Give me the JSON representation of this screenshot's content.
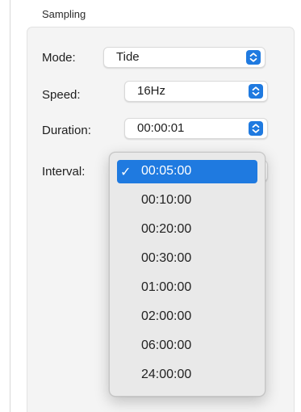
{
  "group": {
    "title": "Sampling"
  },
  "fields": {
    "mode": {
      "label": "Mode:",
      "value": "Tide"
    },
    "speed": {
      "label": "Speed:",
      "value": "16Hz"
    },
    "duration": {
      "label": "Duration:",
      "value": "00:00:01"
    },
    "interval": {
      "label": "Interval:",
      "value": "00:05:00"
    }
  },
  "interval_menu": {
    "selected_index": 0,
    "check_glyph": "✓",
    "options": [
      "00:05:00",
      "00:10:00",
      "00:20:00",
      "00:30:00",
      "01:00:00",
      "02:00:00",
      "06:00:00",
      "24:00:00"
    ]
  },
  "icons": {
    "stepper": "chevron-up-down-icon",
    "check": "checkmark-icon"
  },
  "colors": {
    "accent": "#1f7ae0",
    "group_background": "#f4f4f4",
    "menu_background": "#e9e9e9"
  }
}
